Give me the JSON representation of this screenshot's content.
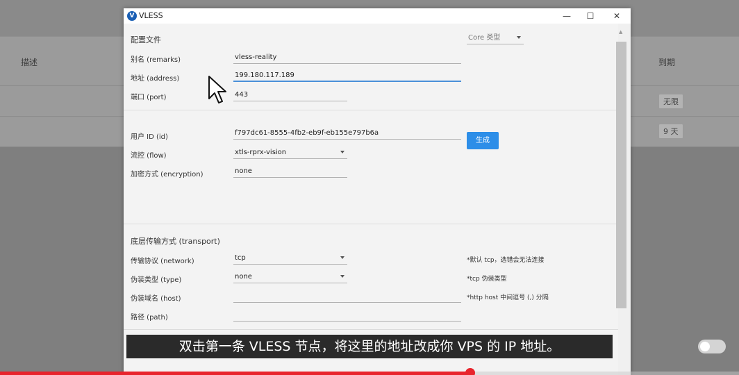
{
  "background": {
    "col_desc": "描述",
    "col_expire": "到期",
    "row1_expire": "无限",
    "row2_expire": "9 天"
  },
  "window": {
    "icon": "V",
    "title": "VLESS",
    "min_glyph": "—",
    "max_glyph": "☐",
    "close_glyph": "✕"
  },
  "profile": {
    "section_title": "配置文件",
    "core_type_placeholder": "Core 类型",
    "remarks_label": "别名 (remarks)",
    "remarks_value": "vless-reality",
    "address_label": "地址 (address)",
    "address_value": "199.180.117.189",
    "port_label": "端口 (port)",
    "port_value": "443"
  },
  "user": {
    "id_label": "用户 ID (id)",
    "id_value": "f797dc61-8555-4fb2-eb9f-eb155e797b6a",
    "generate_label": "生成",
    "flow_label": "流控 (flow)",
    "flow_value": "xtls-rprx-vision",
    "encryption_label": "加密方式 (encryption)",
    "encryption_value": "none"
  },
  "transport": {
    "section_title": "底层传输方式 (transport)",
    "network_label": "传输协议 (network)",
    "network_value": "tcp",
    "network_hint": "*默认 tcp，选错会无法连接",
    "type_label": "伪装类型 (type)",
    "type_value": "none",
    "type_hint": "*tcp 伪装类型",
    "host_label": "伪装域名 (host)",
    "host_value": "",
    "host_hint": "*http host 中间逗号 (,) 分隔",
    "path_label": "路径 (path)",
    "path_value": ""
  },
  "video": {
    "subtitle": "双击第一条 VLESS 节点，将这里的地址改成你 VPS 的 IP 地址。",
    "progress_fraction": 0.636
  },
  "colors": {
    "accent": "#2d8ee8",
    "progress": "#e8242c"
  },
  "icons": {
    "cursor": "arrow-cursor-icon",
    "dropdown": "chevron-down-icon"
  }
}
